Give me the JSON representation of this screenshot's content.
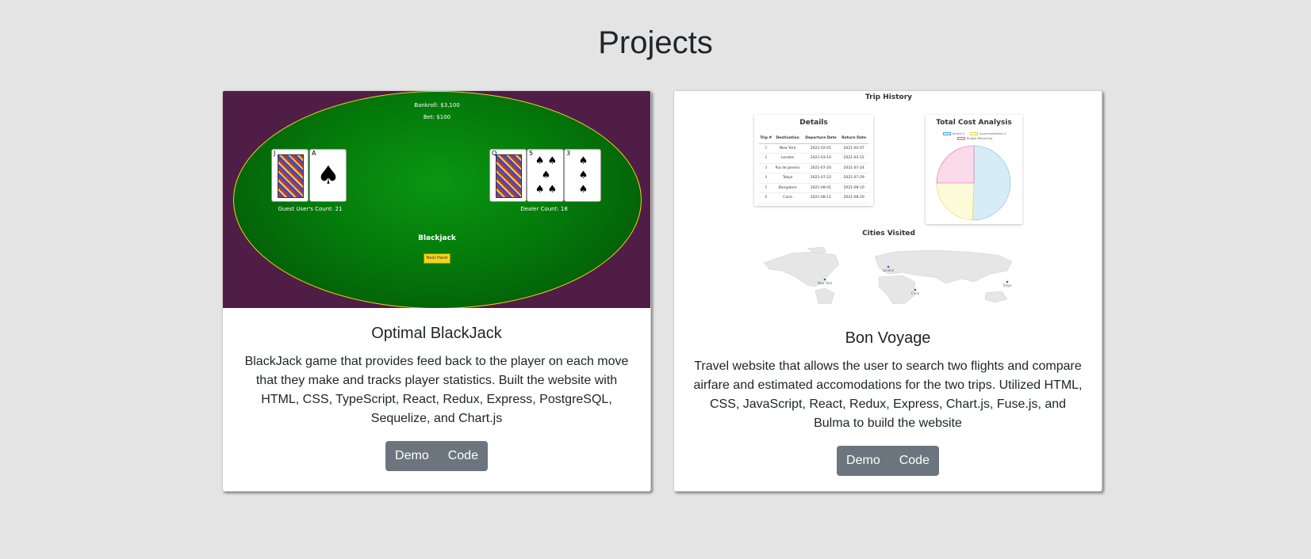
{
  "page": {
    "title": "Projects"
  },
  "projects": [
    {
      "title": "Optimal BlackJack",
      "description": "BlackJack game that provides feed back to the player on each move that they make and tracks player statistics. Built the website with HTML, CSS, TypeScript, React, Redux, Express, PostgreSQL, Sequelize, and Chart.js",
      "demo_label": "Demo",
      "code_label": "Code",
      "preview": {
        "bankroll": "Bankroll: $3,100",
        "bet": "Bet: $100",
        "player_count": "Guest User's Count: 21",
        "dealer_count": "Dealer Count: 18",
        "game_title": "Blackjack",
        "next_hand": "Next Hand",
        "player_cards": [
          {
            "rank": "J",
            "suit": "♣"
          },
          {
            "rank": "A",
            "suit": "♠"
          }
        ],
        "dealer_cards": [
          {
            "rank": "Q",
            "suit": "♣"
          },
          {
            "rank": "5",
            "suit": "♠"
          },
          {
            "rank": "3",
            "suit": "♠"
          }
        ],
        "colors": {
          "felt": "#0a9612",
          "border": "#f2d21a",
          "background": "#4f1d46"
        }
      }
    },
    {
      "title": "Bon Voyage",
      "description": "Travel website that allows the user to search two flights and compare airfare and estimated accomodations for the two trips. Utilized HTML, CSS, JavaScript, React, Redux, Express, Chart.js, Fuse.js, and Bulma to build the website",
      "demo_label": "Demo",
      "code_label": "Code",
      "preview": {
        "trip_history": "Trip History",
        "details_title": "Details",
        "headers": [
          "Trip #",
          "Destination",
          "Departure Date",
          "Return Date"
        ],
        "rows": [
          [
            "1",
            "New York",
            "2021-02-01",
            "2021-02-07"
          ],
          [
            "2",
            "London",
            "2021-03-10",
            "2021-03-15"
          ],
          [
            "3",
            "Rio de Janeiro",
            "2021-07-20",
            "2021-07-24"
          ],
          [
            "4",
            "Tokyo",
            "2021-07-22",
            "2021-07-29"
          ],
          [
            "5",
            "Bangalore",
            "2021-08-01",
            "2021-08-10"
          ],
          [
            "6",
            "Cairo",
            "2021-08-11",
            "2021-08-20"
          ]
        ],
        "cost_title": "Total Cost Analysis",
        "legend": [
          "Airfare $",
          "Accommodations $",
          "Budget Remaining"
        ],
        "pie_colors": [
          "#d6ecf6",
          "#fbfbd9",
          "#fbdbe9"
        ],
        "cities_title": "Cities Visited",
        "cities": [
          "New York",
          "London",
          "Cairo",
          "Tokyo"
        ]
      }
    }
  ]
}
